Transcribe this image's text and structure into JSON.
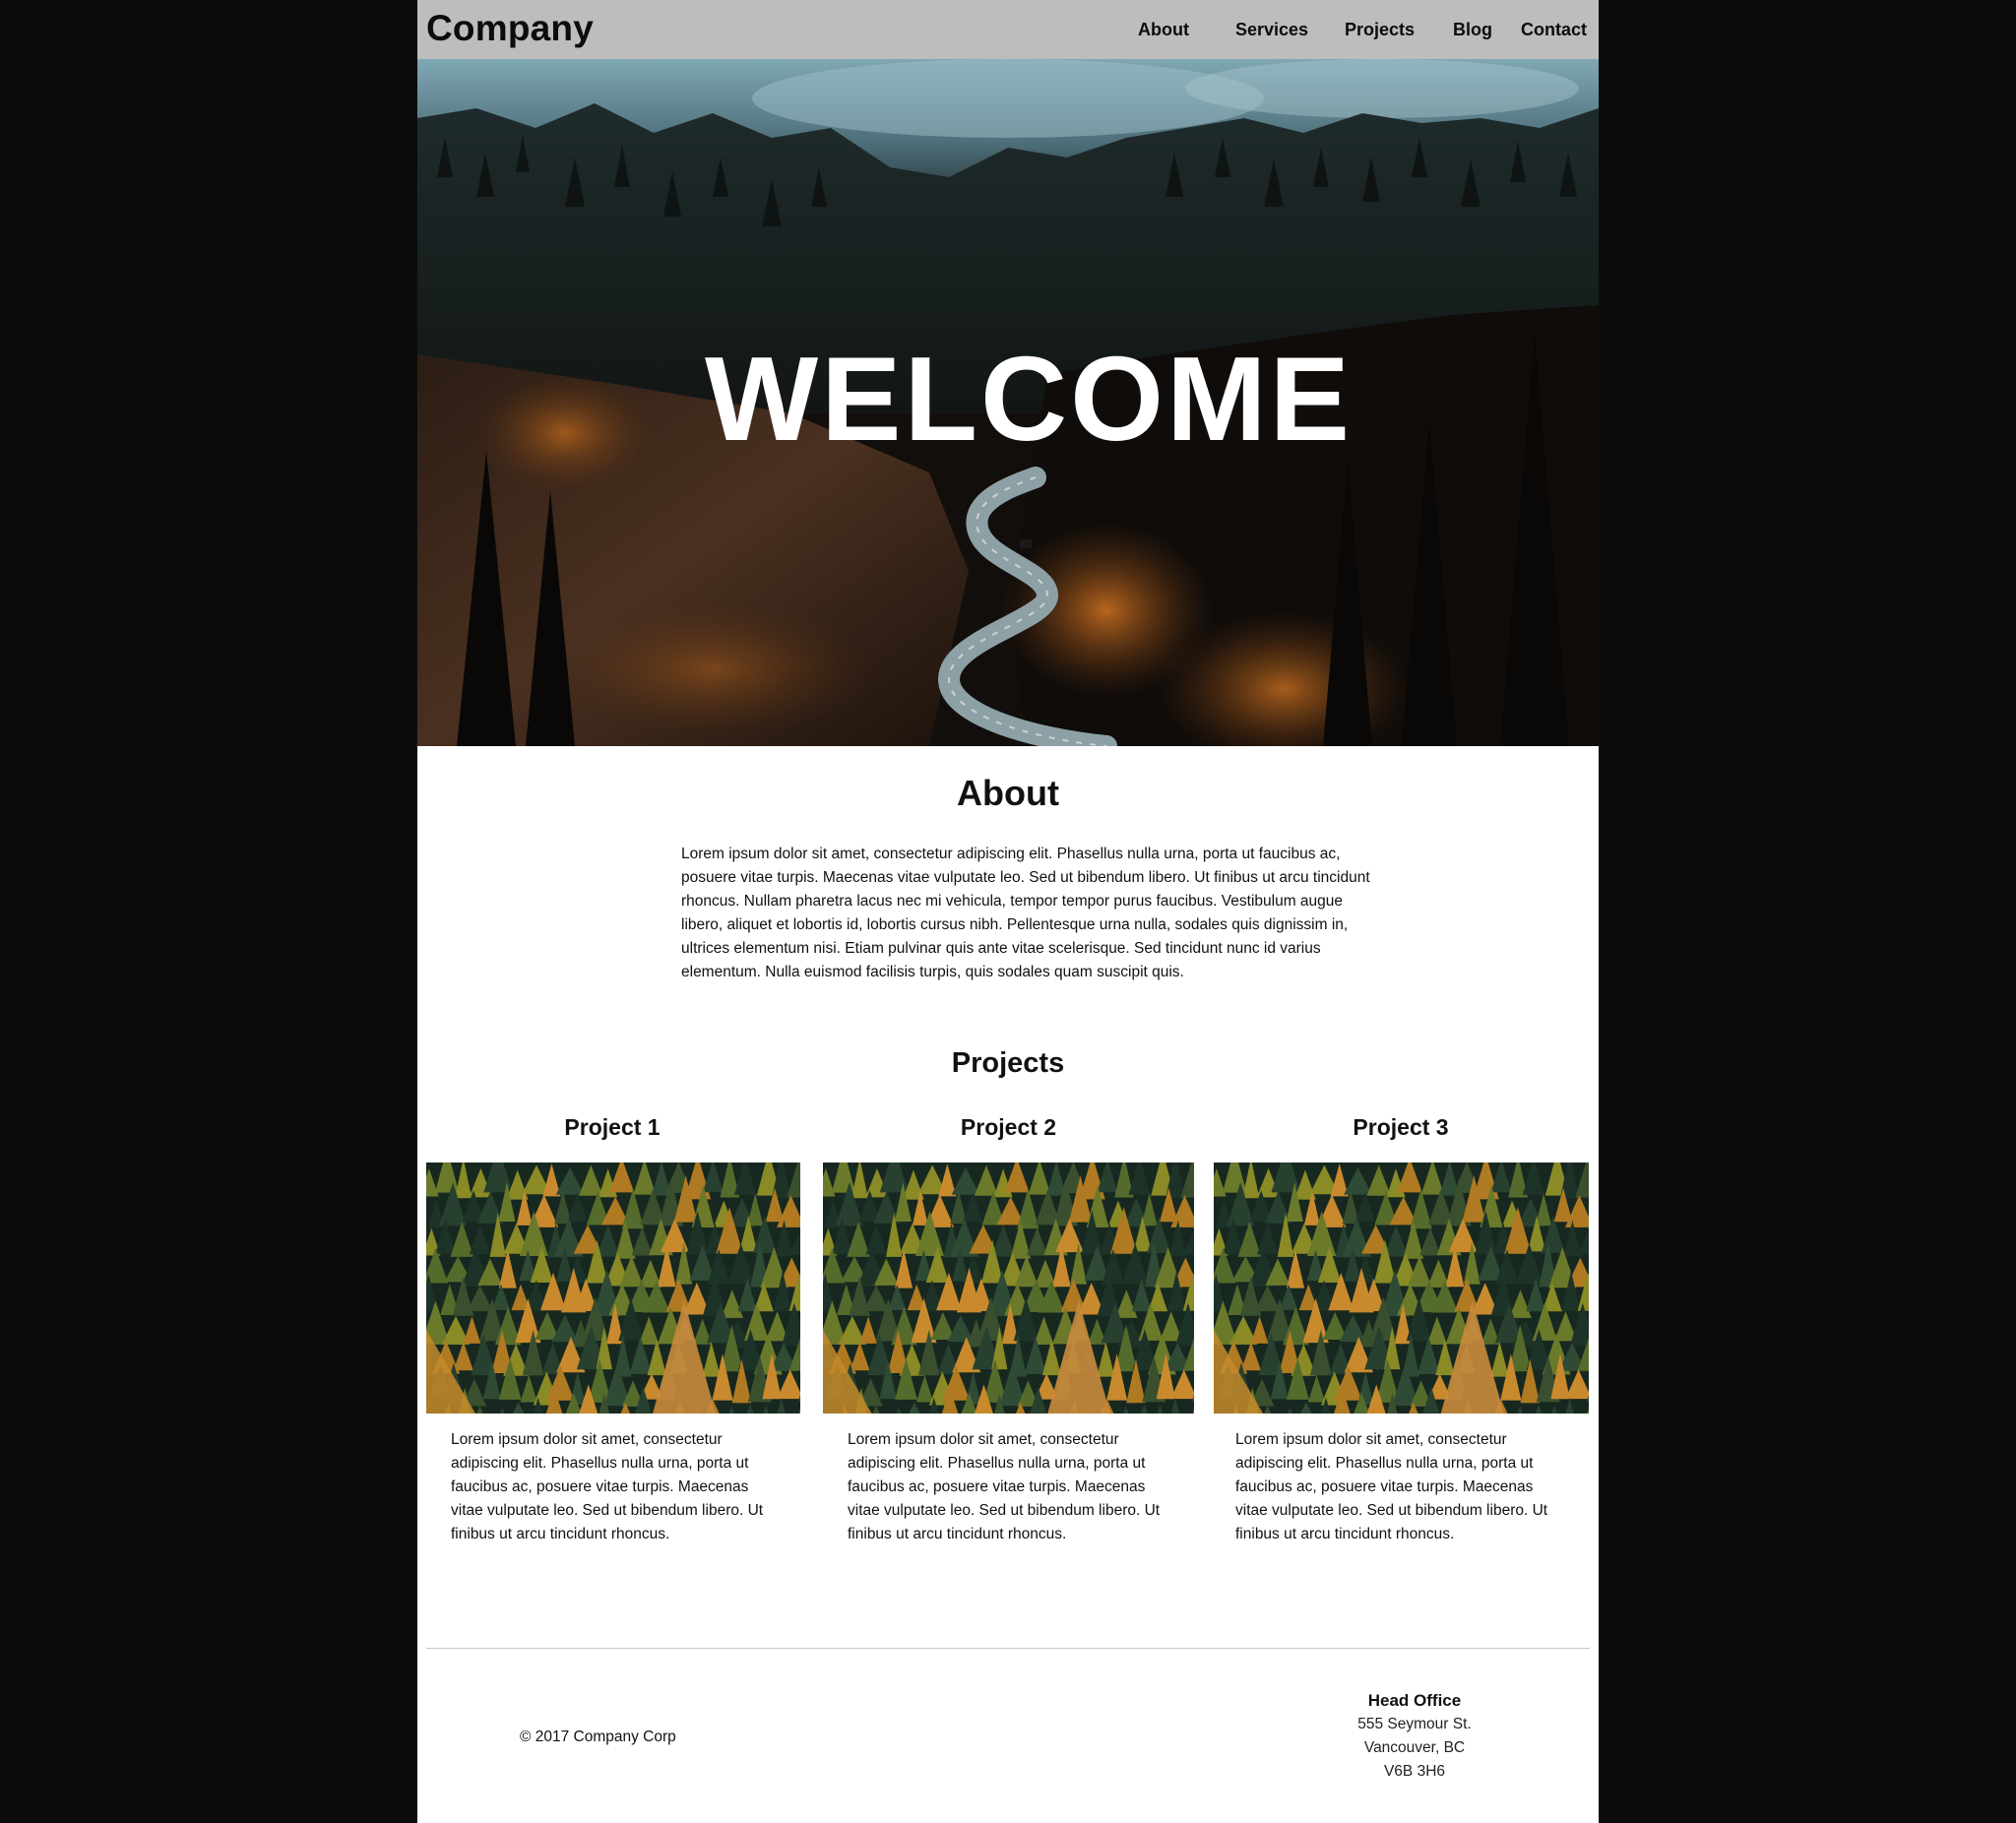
{
  "header": {
    "logo": "Company",
    "nav": [
      "About",
      "Services",
      "Projects",
      "Blog",
      "Contact"
    ]
  },
  "hero": {
    "title": "WELCOME"
  },
  "about": {
    "heading": "About",
    "text": "Lorem ipsum dolor sit amet, consectetur adipiscing elit. Phasellus nulla urna, porta ut faucibus ac, posuere vitae turpis. Maecenas vitae vulputate leo. Sed ut bibendum libero. Ut finibus ut arcu tincidunt rhoncus. Nullam pharetra lacus nec mi vehicula, tempor tempor purus faucibus. Vestibulum augue libero, aliquet et lobortis id, lobortis cursus nibh. Pellentesque urna nulla, sodales quis dignissim in, ultrices elementum nisi. Etiam pulvinar quis ante vitae scelerisque. Sed tincidunt nunc id varius elementum. Nulla euismod facilisis turpis, quis sodales quam suscipit quis."
  },
  "projects": {
    "heading": "Projects",
    "items": [
      {
        "title": "Project 1",
        "text": "Lorem ipsum dolor sit amet, consectetur adipiscing elit. Phasellus nulla urna, porta ut faucibus ac, posuere vitae turpis. Maecenas vitae vulputate leo. Sed ut bibendum libero. Ut finibus ut arcu tincidunt rhoncus."
      },
      {
        "title": "Project 2",
        "text": "Lorem ipsum dolor sit amet, consectetur adipiscing elit. Phasellus nulla urna, porta ut faucibus ac, posuere vitae turpis. Maecenas vitae vulputate leo. Sed ut bibendum libero. Ut finibus ut arcu tincidunt rhoncus."
      },
      {
        "title": "Project 3",
        "text": "Lorem ipsum dolor sit amet, consectetur adipiscing elit. Phasellus nulla urna, porta ut faucibus ac, posuere vitae turpis. Maecenas vitae vulputate leo. Sed ut bibendum libero. Ut finibus ut arcu tincidunt rhoncus."
      }
    ]
  },
  "footer": {
    "copyright": "© 2017 Company Corp",
    "office": {
      "title": "Head Office",
      "lines": [
        "555 Seymour St.",
        "Vancouver, BC",
        "V6B 3H6"
      ]
    }
  },
  "colors": {
    "outer_background": "#0c0c0c",
    "header_background": "#bdbdbd",
    "page_background": "#ffffff",
    "text": "#111111",
    "divider": "#c8c8c8"
  }
}
